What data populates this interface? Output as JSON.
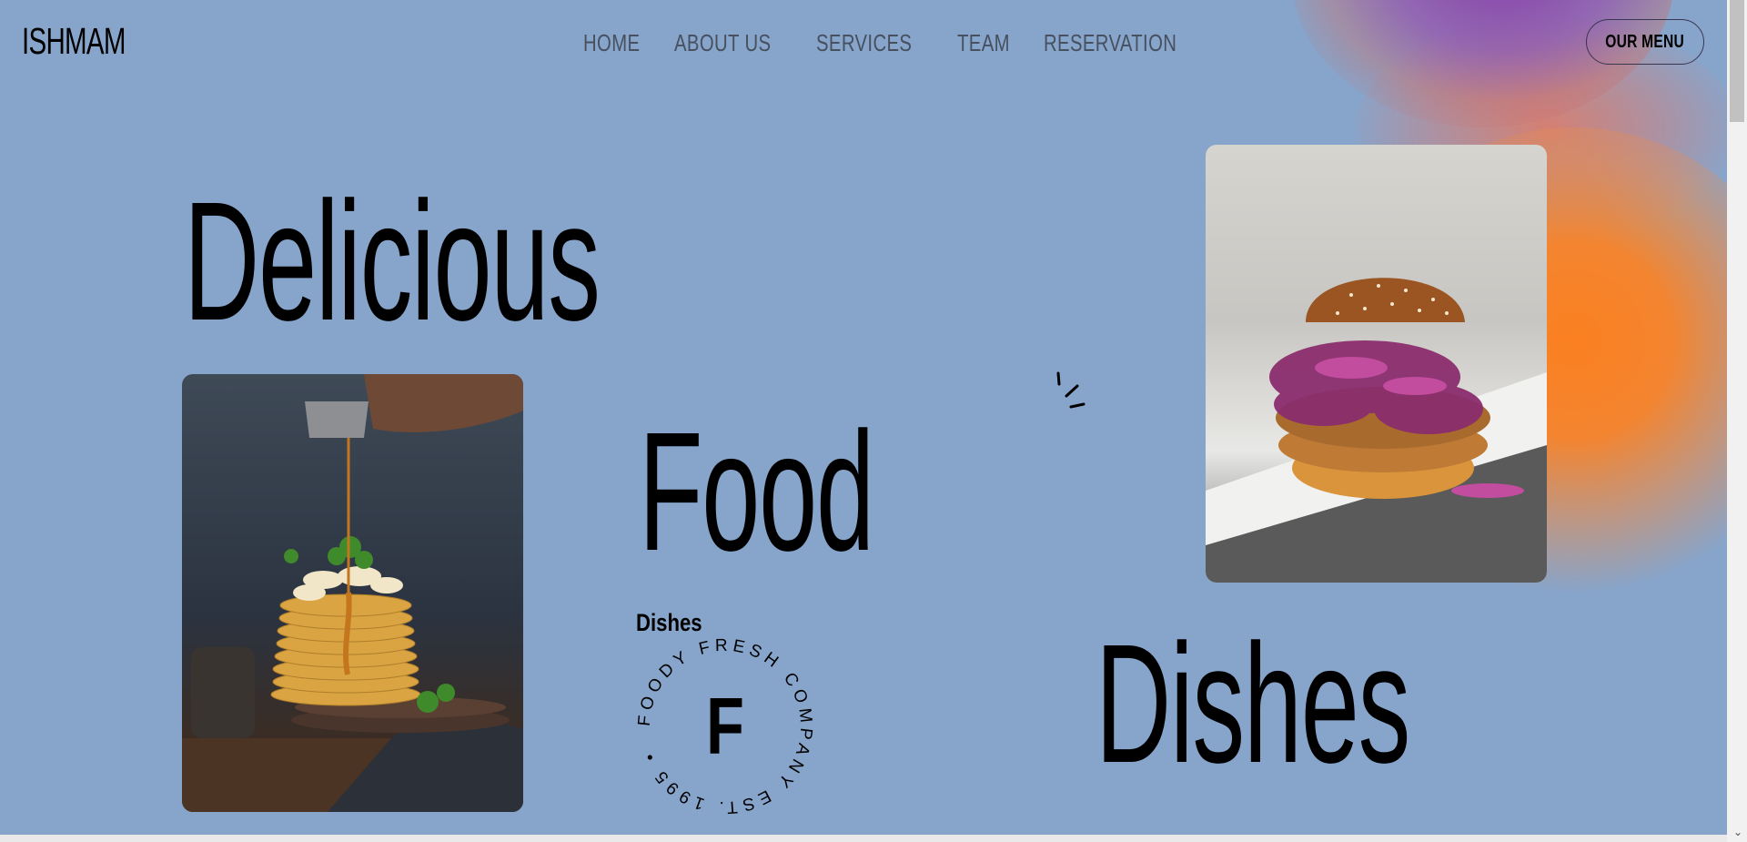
{
  "brand": {
    "logo": "ISHMAM"
  },
  "nav": {
    "items": [
      "HOME",
      "ABOUT US",
      "SERVICES",
      "TEAM",
      "RESERVATION"
    ],
    "menu_button": "OUR MENU"
  },
  "hero": {
    "word1": "Delicious",
    "word2": "Food",
    "word3": "Dishes",
    "small_label": "Dishes",
    "badge_letter": "F",
    "badge_ring": "FOODY FRESH COMPANY EST. 1995 •"
  },
  "colors": {
    "background": "#87a5cb",
    "orange_glow": "#fb8020",
    "purple_glow": "#883eaa"
  },
  "icons": {
    "spark": "spark-lines-icon",
    "pancake_image": "pancake-stack-photo",
    "burger_image": "chicken-burger-photo"
  }
}
